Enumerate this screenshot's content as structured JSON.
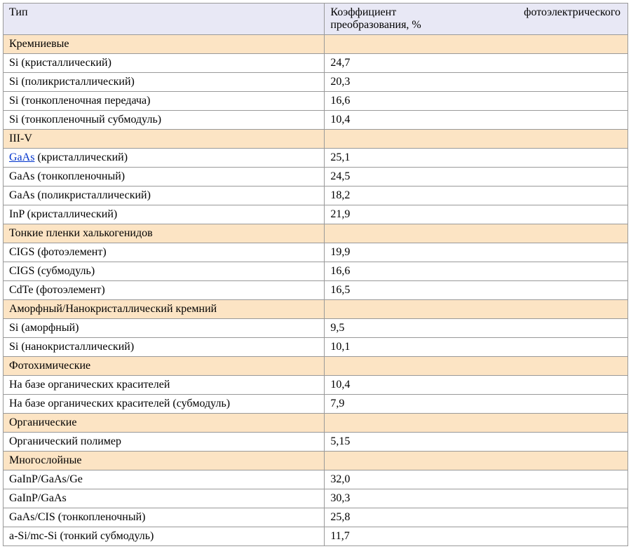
{
  "headers": {
    "type": "Тип",
    "efficiency_word1": "Коэффициент",
    "efficiency_word2": "фотоэлектрического",
    "efficiency_line2": "преобразования, %"
  },
  "rows": [
    {
      "kind": "category",
      "type": "Кремниевые",
      "efficiency": ""
    },
    {
      "kind": "data",
      "type": "Si (кристаллический)",
      "efficiency": "24,7"
    },
    {
      "kind": "data",
      "type": "Si (поликристаллический)",
      "efficiency": "20,3"
    },
    {
      "kind": "data",
      "type": "Si (тонкопленочная передача)",
      "efficiency": "16,6"
    },
    {
      "kind": "data",
      "type": "Si (тонкопленочный субмодуль)",
      "efficiency": "10,4"
    },
    {
      "kind": "category",
      "type": "III-V",
      "efficiency": ""
    },
    {
      "kind": "data",
      "type_link": "GaAs",
      "type_rest": " (кристаллический)",
      "efficiency": "25,1"
    },
    {
      "kind": "data",
      "type": "GaAs (тонкопленочный)",
      "efficiency": "24,5"
    },
    {
      "kind": "data",
      "type": "GaAs (поликристаллический)",
      "efficiency": "18,2"
    },
    {
      "kind": "data",
      "type": "InP (кристаллический)",
      "efficiency": "21,9"
    },
    {
      "kind": "category",
      "type": "Тонкие пленки халькогенидов",
      "efficiency": ""
    },
    {
      "kind": "data",
      "type": "CIGS (фотоэлемент)",
      "efficiency": "19,9"
    },
    {
      "kind": "data",
      "type": "CIGS (субмодуль)",
      "efficiency": "16,6"
    },
    {
      "kind": "data",
      "type": "CdTe (фотоэлемент)",
      "efficiency": "16,5"
    },
    {
      "kind": "category",
      "type": "Аморфный/Нанокристаллический кремний",
      "efficiency": ""
    },
    {
      "kind": "data",
      "type": "Si (аморфный)",
      "efficiency": "9,5"
    },
    {
      "kind": "data",
      "type": "Si (нанокристаллический)",
      "efficiency": "10,1"
    },
    {
      "kind": "category",
      "type": "Фотохимические",
      "efficiency": ""
    },
    {
      "kind": "data",
      "type": "На базе органических красителей",
      "efficiency": "10,4"
    },
    {
      "kind": "data",
      "type": "На базе органических красителей (субмодуль)",
      "efficiency": "7,9"
    },
    {
      "kind": "category",
      "type": "Органические",
      "efficiency": ""
    },
    {
      "kind": "data",
      "type": "Органический полимер",
      "efficiency": "5,15"
    },
    {
      "kind": "category",
      "type": "Многослойные",
      "efficiency": ""
    },
    {
      "kind": "data",
      "type": "GaInP/GaAs/Ge",
      "efficiency": "32,0"
    },
    {
      "kind": "data",
      "type": "GaInP/GaAs",
      "efficiency": "30,3"
    },
    {
      "kind": "data",
      "type": "GaAs/CIS (тонкопленочный)",
      "efficiency": "25,8"
    },
    {
      "kind": "data",
      "type": "a-Si/mc-Si (тонкий субмодуль)",
      "efficiency": "11,7"
    }
  ]
}
